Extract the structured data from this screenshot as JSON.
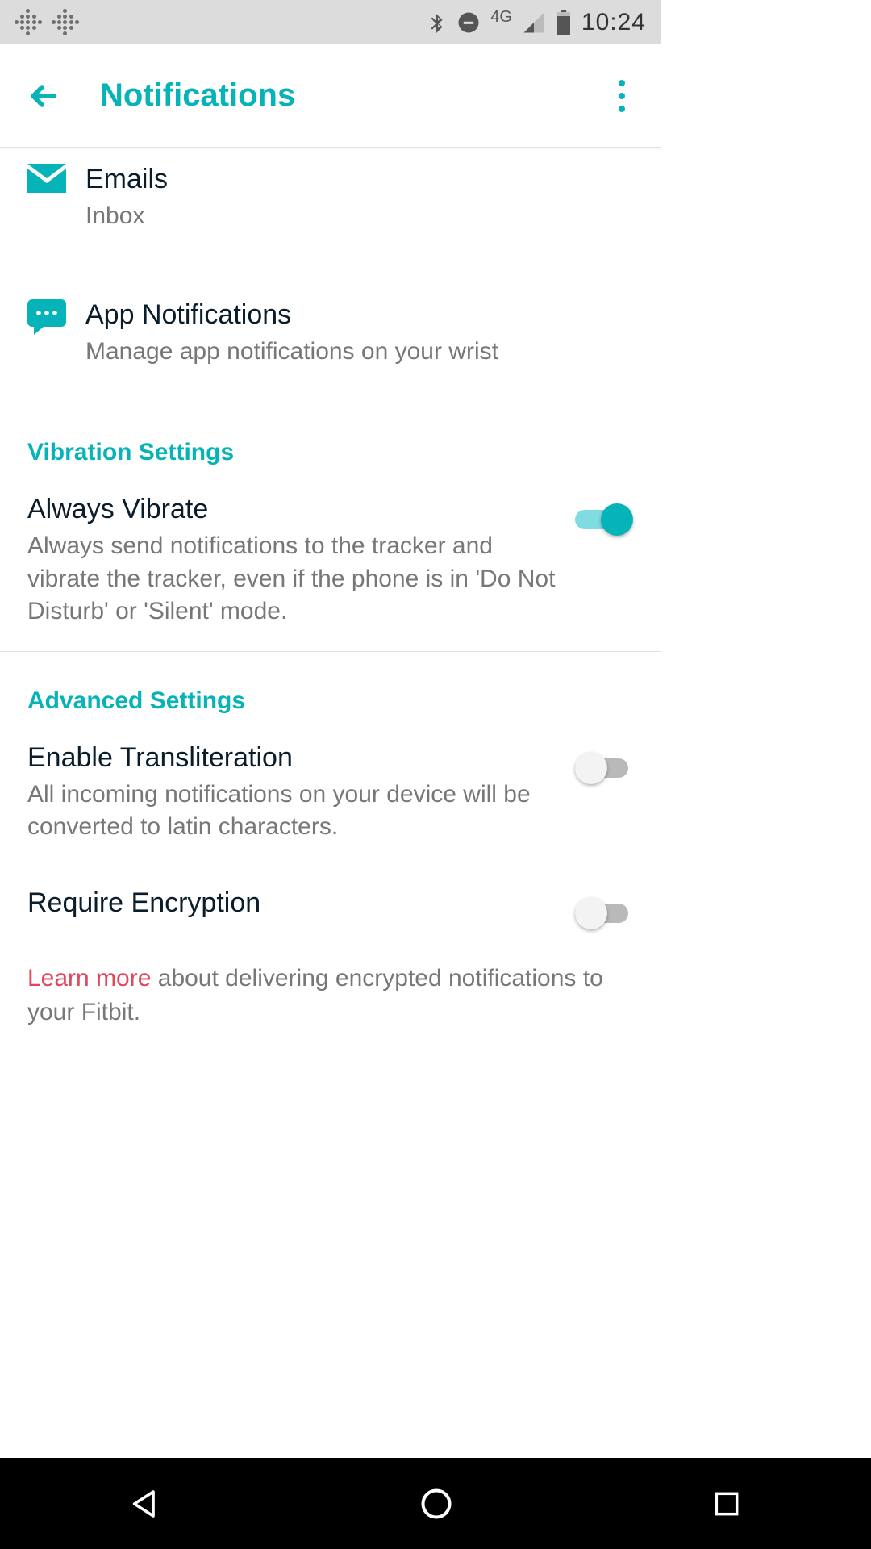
{
  "status": {
    "time": "10:24",
    "network": "4G"
  },
  "appbar": {
    "title": "Notifications"
  },
  "items": {
    "emails": {
      "title": "Emails",
      "subtitle": "Inbox"
    },
    "apps": {
      "title": "App Notifications",
      "subtitle": "Manage app notifications on your wrist"
    }
  },
  "sections": {
    "vibration": {
      "header": "Vibration Settings",
      "always_vibrate": {
        "title": "Always Vibrate",
        "desc": "Always send notifications to the tracker and vibrate the tracker, even if the phone is in 'Do Not Disturb' or 'Silent' mode.",
        "on": true
      }
    },
    "advanced": {
      "header": "Advanced Settings",
      "transliteration": {
        "title": "Enable Transliteration",
        "desc": "All incoming notifications on your device will be converted to latin characters.",
        "on": false
      },
      "encryption": {
        "title": "Require Encryption",
        "on": false
      },
      "learn_more": {
        "link": "Learn more",
        "rest": " about delivering encrypted notifications to your Fitbit."
      }
    }
  }
}
